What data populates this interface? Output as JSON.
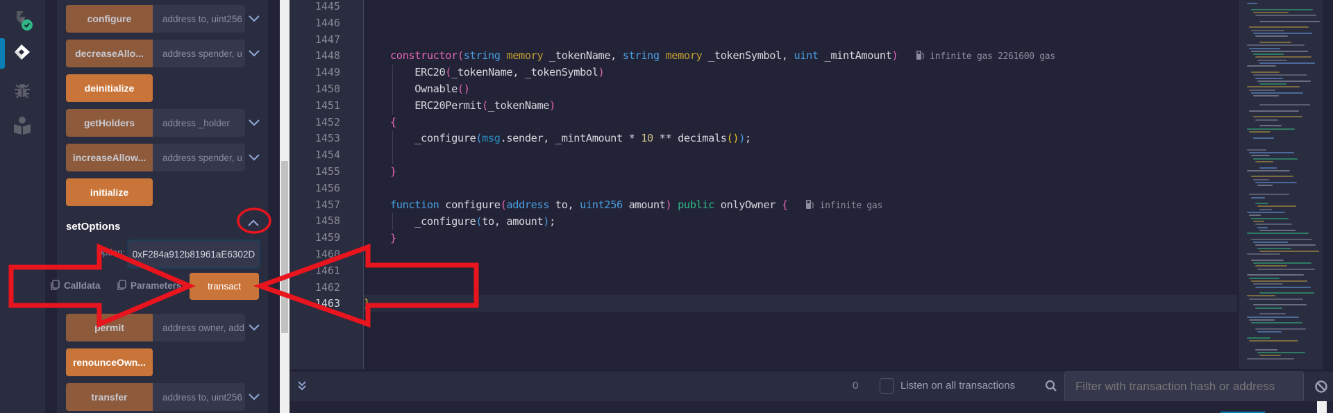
{
  "icon_bar": {
    "items": [
      {
        "name": "solidity-compiler",
        "icon": "compiler-icon",
        "status": "check-badge"
      },
      {
        "name": "deploy-run",
        "icon": "ethereum-icon",
        "active": true
      },
      {
        "name": "debugger",
        "icon": "bug-icon"
      },
      {
        "name": "learneth",
        "icon": "book-reader-icon"
      }
    ]
  },
  "functions": [
    {
      "label": "configure",
      "type": "call",
      "placeholder": "address to, uint256",
      "expandable": true
    },
    {
      "label": "decreaseAllo...",
      "type": "call",
      "placeholder": "address spender, u",
      "expandable": true
    },
    {
      "label": "deinitialize",
      "type": "transact"
    },
    {
      "label": "getHolders",
      "type": "call",
      "placeholder": "address _holder",
      "expandable": true
    },
    {
      "label": "increaseAllow...",
      "type": "call",
      "placeholder": "address spender, u",
      "expandable": true
    },
    {
      "label": "initialize",
      "type": "transact"
    }
  ],
  "expanded_function": {
    "name": "setOptions",
    "param_label": "option:",
    "param_value": "0xF284a912b81961aE6302D",
    "calldata_label": "Calldata",
    "parameters_label": "Parameters",
    "transact_label": "transact"
  },
  "functions_after": [
    {
      "label": "permit",
      "type": "call",
      "placeholder": "address owner, add",
      "expandable": true
    },
    {
      "label": "renounceOwn...",
      "type": "transact"
    },
    {
      "label": "transfer",
      "type": "call",
      "placeholder": "address to, uint256",
      "expandable": true
    }
  ],
  "editor": {
    "line_numbers": [
      "1445",
      "1446",
      "1447",
      "1448",
      "1449",
      "1450",
      "1451",
      "1452",
      "1453",
      "1454",
      "1455",
      "1456",
      "1457",
      "1458",
      "1459",
      "1460",
      "1461",
      "1462",
      "1463"
    ],
    "current_line": "1463",
    "gas_constructor": "infinite gas 2261600 gas",
    "gas_configure": "infinite gas"
  },
  "terminal": {
    "pending_count": "0",
    "listen_label": "Listen on all transactions",
    "listen_checked": false,
    "filter_placeholder": "Filter with transaction hash or address"
  },
  "annotations": {
    "color": "#e8141e",
    "items": [
      "circle around setOptions collapse chevron",
      "arrow pointing right to transact button",
      "arrow pointing left to transact button"
    ]
  }
}
